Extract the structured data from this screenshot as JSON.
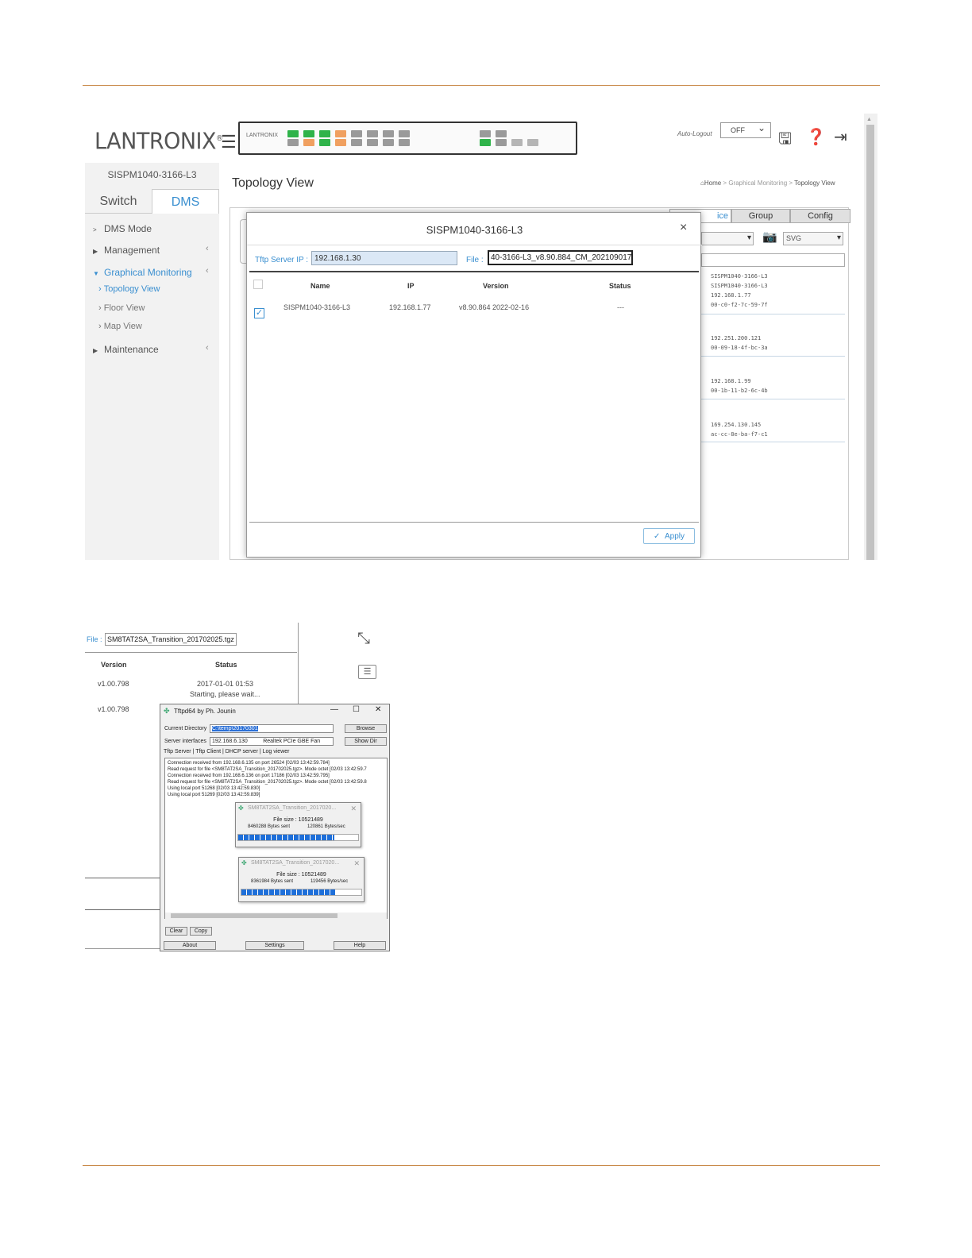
{
  "screenshot1": {
    "logo": "LANTRONIX",
    "logo_mark": "®",
    "panel_logo": "LANTRONIX",
    "auto_logout_label": "Auto-Logout",
    "auto_logout_value": "OFF",
    "icons": {
      "menu": "hamburger-icon",
      "save": "save-icon",
      "help": "help-icon",
      "logout": "logout-icon",
      "camera": "camera-icon"
    },
    "device_name": "SISPM1040-3166-L3",
    "tabs": {
      "switch": "Switch",
      "dms": "DMS"
    },
    "nav": [
      {
        "label": "DMS Mode"
      },
      {
        "label": "Management"
      },
      {
        "label": "Graphical Monitoring"
      },
      {
        "label": "Maintenance"
      }
    ],
    "subnav": [
      {
        "label": "Topology View"
      },
      {
        "label": "Floor View"
      },
      {
        "label": "Map View"
      }
    ],
    "page_title": "Topology View",
    "breadcrumb": {
      "home": "Home",
      "sep": ">",
      "section": "Graphical Monitoring",
      "page": "Topology View"
    },
    "right_tabs": [
      "ice",
      "Group",
      "Config"
    ],
    "right_export": "SVG",
    "devices": [
      {
        "lines": [
          "SISPM1040-3166-L3",
          "SISPM1040-3166-L3",
          "192.168.1.77",
          "00-c0-f2-7c-59-7f"
        ]
      },
      {
        "lines": [
          "192.251.200.121",
          "00-09-18-4f-bc-3a"
        ]
      },
      {
        "lines": [
          "192.168.1.99",
          "00-1b-11-b2-6c-4b"
        ]
      },
      {
        "lines": [
          "169.254.130.145",
          "ac-cc-8e-ba-f7-c1"
        ]
      }
    ],
    "modal": {
      "title": "SISPM1040-3166-L3",
      "close": "×",
      "tftp_label": "Tftp Server IP :",
      "tftp_value": "192.168.1.30",
      "file_label": "File :",
      "file_value": "40-3166-L3_v8.90.884_CM_202109017",
      "columns": [
        "Name",
        "IP",
        "Version",
        "Status"
      ],
      "row": {
        "name": "SISPM1040-3166-L3",
        "ip": "192.168.1.77",
        "version": "v8.90.864 2022-02-16",
        "status": "---"
      },
      "apply": "Apply"
    }
  },
  "screenshot2": {
    "file_label": "File :",
    "file_value": "SM8TAT2SA_Transition_201702025.tgz",
    "columns": [
      "Version",
      "Status"
    ],
    "rows": [
      {
        "version": "v1.00.798",
        "status": "2017-01-01 01:53",
        "status2": "Starting, please wait..."
      },
      {
        "version": "v1.00.798"
      }
    ],
    "tftpd": {
      "title": "Tftpd64 by Ph. Jounin",
      "current_dir_label": "Current Directory",
      "current_dir_value": "C:\\temp\\20170301",
      "server_if_label": "Server interfaces",
      "server_if_value": "192.168.6.130",
      "server_if_adapter": "Realtek PCIe GBE Fan",
      "browse": "Browse",
      "show_dir": "Show Dir",
      "tabs": "Tftp Server | Tftp Client | DHCP server | Log viewer",
      "log": [
        "Connection received from 192.168.6.135 on port 26524 [02/03 13:42:59.784]",
        "Read request for file <SM8TAT2SA_Transition_201702025.tgz>. Mode octet [02/03 13:42:59.7",
        "Connection received from 192.168.6.136 on port 17186 [02/03 13:42:59.795]",
        "Read request for file <SM8TAT2SA_Transition_201702025.tgz>. Mode octet [02/03 13:42:59.8",
        "Using local port 51268 [02/03 13:42:59.830]",
        "Using local port 51269 [02/03 13:42:59.839]"
      ],
      "progress": [
        {
          "title": "SM8TAT2SA_Transition_2017020...",
          "file_size": "File size : 10521489",
          "sent": "8460288 Bytes sent",
          "rate": "120861 Bytes/sec",
          "fraction": 0.8
        },
        {
          "title": "SM8TAT2SA_Transition_2017020...",
          "file_size": "File size : 10521489",
          "sent": "8361984 Bytes sent",
          "rate": "119456 Bytes/sec",
          "fraction": 0.79
        }
      ],
      "clear": "Clear",
      "copy": "Copy",
      "about": "About",
      "settings": "Settings",
      "help": "Help"
    }
  },
  "colors": {
    "accent": "#3a8fd0",
    "rule": "#c98a4a",
    "progress": "#1e6fd9"
  }
}
